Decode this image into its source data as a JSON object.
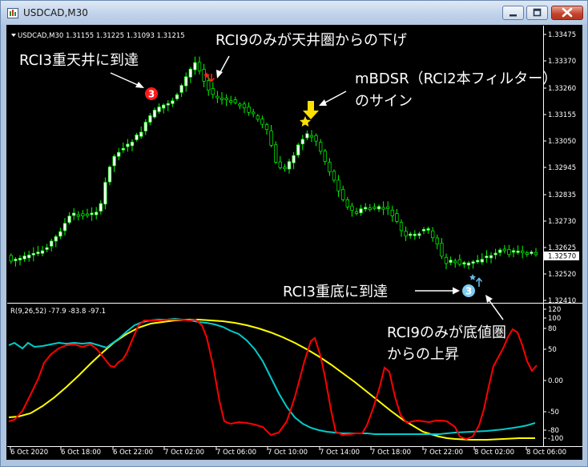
{
  "window": {
    "title": "USDCAD,M30",
    "icon": "chart-window-icon",
    "controls": [
      "minimize-icon",
      "maximize-icon",
      "close-icon"
    ]
  },
  "price_panel": {
    "symbol_info": "USDCAD,M30  1.31155 1.31225 1.31093 1.31215",
    "price_labels": [
      "1.33475",
      "1.33370",
      "1.33260",
      "1.33155",
      "1.33050",
      "1.32945",
      "1.32835",
      "1.32730",
      "1.32625",
      "1.32520",
      "1.32410"
    ],
    "last_price": "1.32570"
  },
  "indicator_panel": {
    "info": "R(9,26,52) -77.9 -83.8 -97.1",
    "scale_labels": [
      "120",
      "100",
      "80",
      "50",
      "0.00",
      "-50",
      "-80",
      "-100"
    ]
  },
  "time_labels": [
    "6 Oct 2020",
    "6 Oct 18:00",
    "6 Oct 22:00",
    "7 Oct 02:00",
    "7 Oct 06:00",
    "7 Oct 10:00",
    "7 Oct 14:00",
    "7 Oct 18:00",
    "7 Oct 22:00",
    "8 Oct 02:00",
    "8 Oct 06:00"
  ],
  "annotations": {
    "rci3_top": "RCI3重天井に到達",
    "rci9_top": "RCI9のみが天井圏からの下げ",
    "mbdsr_1": "mBDSR（RCI2本フィルター）",
    "mbdsr_2": "のサイン",
    "rci3_bottom": "RCI3重底に到達",
    "rci9_bottom_1": "RCI9のみが底値圏",
    "rci9_bottom_2": "からの上昇",
    "marker_3": "3"
  },
  "colors": {
    "background": "#000000",
    "bull_candle": "#ffffff",
    "bear_candle": "#000000",
    "candle_wick": "#00ff00",
    "rci_short": "#ff0000",
    "rci_mid": "#00cccc",
    "rci_long": "#ffff00",
    "top_marker": "#ff1a1a",
    "bottom_marker": "#7ecbf2",
    "sell_arrow": "#ffe000"
  }
}
